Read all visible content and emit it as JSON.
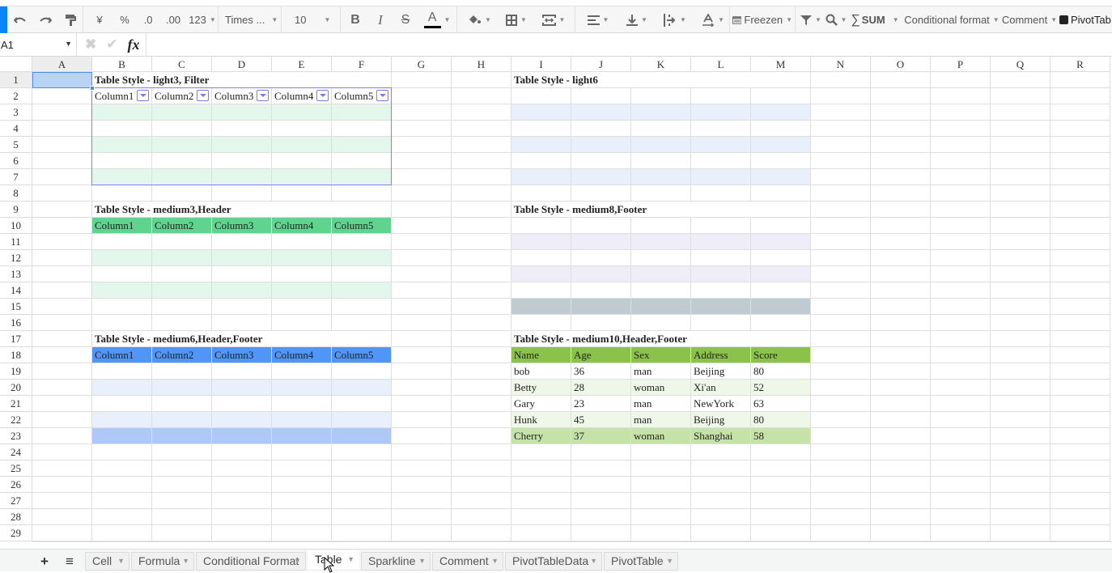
{
  "toolbar": {
    "undo_icon": "undo-icon",
    "redo_icon": "redo-icon",
    "paint_format_icon": "paint-format-icon",
    "currency": "¥",
    "percent": "%",
    "decrease_decimal": ".0",
    "increase_decimal": ".00",
    "number_format": "123",
    "font_family": "Times ...",
    "font_size": "10",
    "bold": "B",
    "italic": "I",
    "strike": "S",
    "font_color": "A",
    "freeze": "Freezen",
    "sum": "SUM",
    "sigma": "∑",
    "conditional_format": "Conditional format",
    "comment": "Comment",
    "pivot_table": "PivotTab",
    "accent_color": "#0a84ff"
  },
  "formula_bar": {
    "cell_ref": "A1",
    "fx": "fx",
    "value": ""
  },
  "columns": [
    "A",
    "B",
    "C",
    "D",
    "E",
    "F",
    "G",
    "H",
    "I",
    "J",
    "K",
    "L",
    "M",
    "N",
    "O",
    "P",
    "Q",
    "R"
  ],
  "selected_cell": "A1",
  "rows": [
    "1",
    "2",
    "3",
    "4",
    "5",
    "6",
    "7",
    "8",
    "9",
    "10",
    "11",
    "12",
    "13",
    "14",
    "15",
    "16",
    "17",
    "18",
    "19",
    "20",
    "21",
    "22",
    "23",
    "24",
    "25",
    "26",
    "27",
    "28",
    "29"
  ],
  "tables": {
    "light3": {
      "title": "Table Style - light3, Filter",
      "headers": [
        "Column1",
        "Column2",
        "Column3",
        "Column4",
        "Column5"
      ],
      "band_color": "#e3f7ec",
      "border_color": "#8080ee"
    },
    "light6": {
      "title": "Table Style - light6",
      "band_color": "#eaf0fb"
    },
    "medium3": {
      "title": "Table Style - medium3,Header",
      "headers": [
        "Column1",
        "Column2",
        "Column3",
        "Column4",
        "Column5"
      ],
      "header_color": "#5fd38f",
      "band_color": "#e3f7ec"
    },
    "medium8": {
      "title": "Table Style - medium8,Footer",
      "band_color": "#efeef8",
      "footer_color": "#bfcbd1"
    },
    "medium6": {
      "title": "Table Style - medium6,Header,Footer",
      "headers": [
        "Column1",
        "Column2",
        "Column3",
        "Column4",
        "Column5"
      ],
      "header_color": "#5096f8",
      "band_color": "#eaf0fb",
      "footer_color": "#aec9f7"
    },
    "medium10": {
      "title": "Table Style - medium10,Header,Footer",
      "headers": [
        "Name",
        "Age",
        "Sex",
        "Address",
        "Score"
      ],
      "rows": [
        [
          "bob",
          "36",
          "man",
          "Beijing",
          "80"
        ],
        [
          "Betty",
          "28",
          "woman",
          "Xi'an",
          "52"
        ],
        [
          "Gary",
          "23",
          "man",
          "NewYork",
          "63"
        ],
        [
          "Hunk",
          "45",
          "man",
          "Beijing",
          "80"
        ],
        [
          "Cherry",
          "37",
          "woman",
          "Shanghai",
          "58"
        ]
      ],
      "header_color": "#8bc34a",
      "band_color": "#eff7e8",
      "footer_color": "#c5e3a8"
    }
  },
  "sheet_tabs": {
    "add_label": "+",
    "menu_label": "≡",
    "tabs": [
      "Cell",
      "Formula",
      "Conditional Format",
      "Table",
      "Sparkline",
      "Comment",
      "PivotTableData",
      "PivotTable"
    ],
    "active": "Table"
  }
}
